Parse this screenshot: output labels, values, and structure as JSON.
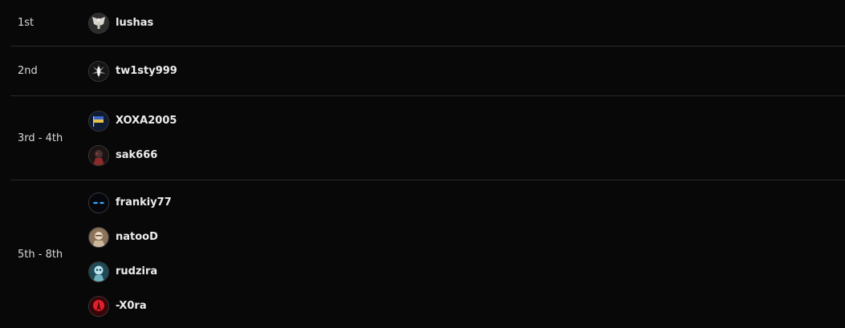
{
  "standings": [
    {
      "place": "1st",
      "players": [
        {
          "name": "lushas",
          "avatar": "angel-wings-avatar",
          "colors": [
            "#2c2c2c",
            "#d9d6cf"
          ]
        }
      ]
    },
    {
      "place": "2nd",
      "players": [
        {
          "name": "tw1sty999",
          "avatar": "glowing-figure-avatar",
          "colors": [
            "#151515",
            "#f2f2f2"
          ]
        }
      ]
    },
    {
      "place": "3rd - 4th",
      "players": [
        {
          "name": "XOXA2005",
          "avatar": "flag-avatar",
          "colors": [
            "#0f1a33",
            "#e8c34a"
          ]
        },
        {
          "name": "sak666",
          "avatar": "dark-red-character-avatar",
          "colors": [
            "#1c1414",
            "#8b2a2a"
          ]
        }
      ]
    },
    {
      "place": "5th - 8th",
      "players": [
        {
          "name": "frankiy77",
          "avatar": "blue-eyes-avatar",
          "colors": [
            "#05070c",
            "#36a8ff"
          ]
        },
        {
          "name": "natooD",
          "avatar": "portrait-avatar",
          "colors": [
            "#8a7359",
            "#e9d8c2"
          ]
        },
        {
          "name": "rudzira",
          "avatar": "teal-character-avatar",
          "colors": [
            "#1f4a57",
            "#bfe6ee"
          ]
        },
        {
          "name": "-X0ra",
          "avatar": "red-glow-avatar",
          "colors": [
            "#3a0508",
            "#e2202a"
          ]
        }
      ]
    }
  ]
}
